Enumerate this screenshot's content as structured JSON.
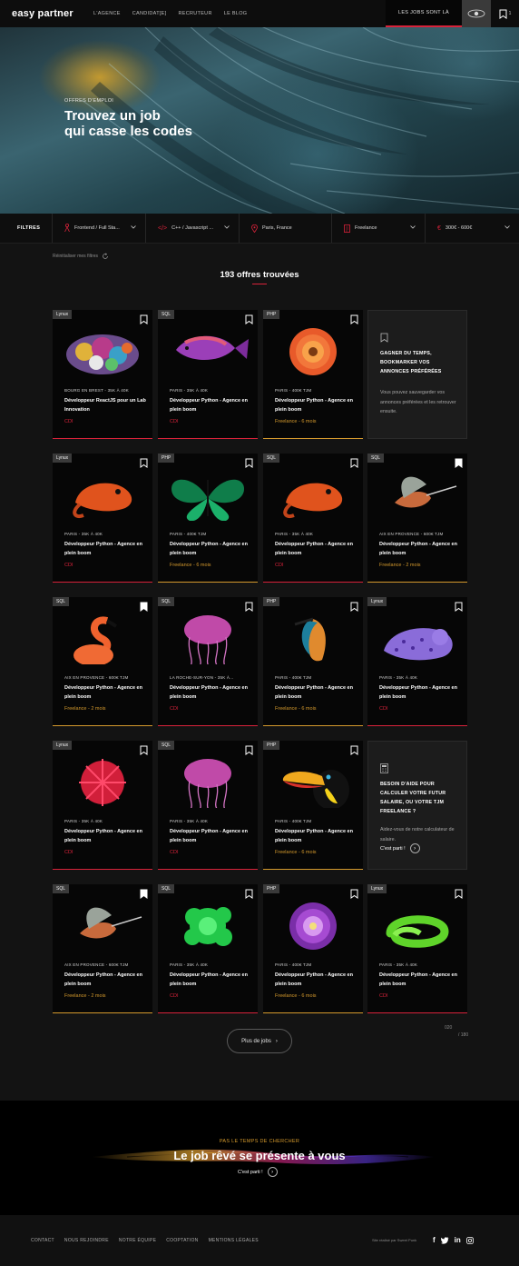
{
  "header": {
    "logo": "easy partner",
    "nav": [
      "L'AGENCE",
      "CANDIDAT[E]",
      "RECRUTEUR",
      "LE BLOG"
    ],
    "jobs_button": "LES JOBS SONT LÀ",
    "bookmark_count": "1"
  },
  "hero": {
    "kicker": "OFFRES D'EMPLOI",
    "title_line1": "Trouvez un job",
    "title_line2": "qui casse les codes"
  },
  "filters": {
    "label": "FILTRES",
    "items": [
      {
        "label": "Frontend / Full Sta...",
        "icon": "person-icon"
      },
      {
        "label": "C++ / Javascript ...",
        "icon": "code-icon"
      },
      {
        "label": "Paris, France",
        "icon": "location-icon"
      },
      {
        "label": "Freelance",
        "icon": "document-icon"
      },
      {
        "label": "300€ - 600€",
        "icon": "euro-icon"
      }
    ],
    "reset": "Réinitialiser mes filtres"
  },
  "results": {
    "title": "193 offres trouvées"
  },
  "colors": {
    "accent_red": "#d8223a",
    "accent_orange": "#d59a2d"
  },
  "cards": [
    {
      "tag": "Lynux",
      "loc": "BOURG EN BREST - 35K À 40K",
      "title": "Développeur ReactJS pour un Lab Innovation",
      "type": "CDI",
      "kind": "cdi",
      "bm": "outline",
      "image": "gemstones"
    },
    {
      "tag": "SQL",
      "loc": "PARIS - 35K À 40K",
      "title": "Développeur Python - Agence en plein boom",
      "type": "CDI",
      "kind": "cdi",
      "bm": "outline",
      "image": "tropical-fish"
    },
    {
      "tag": "PHP",
      "loc": "PARIS - 400€ TJM",
      "title": "Développeur Python - Agence en plein boom",
      "type": "Freelance - 6 mois",
      "kind": "free",
      "bm": "outline",
      "image": "dahlia-flower"
    },
    {
      "promo": true,
      "p_title": "GAGNER DU TEMPS, BOOKMARKER VOS ANNONCES PRÉFÉRÉES",
      "p_text": "Vous pouvez sauvegarder vos annonces préférées et les retrouver ensuite."
    },
    {
      "tag": "Lynux",
      "loc": "PARIS - 35K À 40K",
      "title": "Développeur Python - Agence en plein boom",
      "type": "CDI",
      "kind": "cdi",
      "bm": "outline",
      "image": "chameleon"
    },
    {
      "tag": "PHP",
      "loc": "PARIS - 400€ TJM",
      "title": "Développeur Python - Agence en plein boom",
      "type": "Freelance - 6 mois",
      "kind": "free",
      "bm": "outline",
      "image": "butterfly"
    },
    {
      "tag": "SQL",
      "loc": "PARIS - 35K À 40K",
      "title": "Développeur Python - Agence en plein boom",
      "type": "CDI",
      "kind": "cdi",
      "bm": "outline",
      "image": "chameleon"
    },
    {
      "tag": "SQL",
      "loc": "AIX EN PROVENCE - 600€ TJM",
      "title": "Développeur Python - Agence en plein boom",
      "type": "Freelance - 2 mois",
      "kind": "free",
      "bm": "filled",
      "image": "hummingbird"
    },
    {
      "tag": "SQL",
      "loc": "AIX EN PROVENCE - 600€ TJM",
      "title": "Développeur Python - Agence en plein boom",
      "type": "Freelance - 2 mois",
      "kind": "free",
      "bm": "filled",
      "image": "flamingo"
    },
    {
      "tag": "SQL",
      "loc": "LA ROCHE-SUR-YON - 35K À...",
      "title": "Développeur Python - Agence en plein boom",
      "type": "CDI",
      "kind": "cdi",
      "bm": "outline",
      "image": "jellyfish"
    },
    {
      "tag": "PHP",
      "loc": "PARIS - 400€ TJM",
      "title": "Développeur Python - Agence en plein boom",
      "type": "Freelance - 6 mois",
      "kind": "free",
      "bm": "outline",
      "image": "kingfisher"
    },
    {
      "tag": "Lynux",
      "loc": "PARIS - 35K À 40K",
      "title": "Développeur Python - Agence en plein boom",
      "type": "CDI",
      "kind": "cdi",
      "bm": "outline",
      "image": "snow-leopard"
    },
    {
      "tag": "Lynux",
      "loc": "PARIS - 35K À 40K",
      "title": "Développeur Python - Agence en plein boom",
      "type": "CDI",
      "kind": "cdi",
      "bm": "outline",
      "image": "red-flower"
    },
    {
      "tag": "SQL",
      "loc": "PARIS - 35K À 40K",
      "title": "Développeur Python - Agence en plein boom",
      "type": "CDI",
      "kind": "cdi",
      "bm": "outline",
      "image": "jellyfish"
    },
    {
      "tag": "PHP",
      "loc": "PARIS - 400€ TJM",
      "title": "Développeur Python - Agence en plein boom",
      "type": "Freelance - 6 mois",
      "kind": "free",
      "bm": "outline",
      "image": "toucan"
    },
    {
      "promo": true,
      "p_title": "BESOIN D'AIDE POUR CALCULER VOTRE FUTUR SALAIRE, OU VOTRE TJM FREELANCE ?",
      "p_text": "Aidez-vous de notre calculateur de salaire.",
      "p_cta": "C'est parti !"
    },
    {
      "tag": "SQL",
      "loc": "AIX EN PROVENCE - 600€ TJM",
      "title": "Développeur Python - Agence en plein boom",
      "type": "Freelance - 2 mois",
      "kind": "free",
      "bm": "filled",
      "image": "hummingbird"
    },
    {
      "tag": "SQL",
      "loc": "PARIS - 35K À 40K",
      "title": "Développeur Python - Agence en plein boom",
      "type": "CDI",
      "kind": "cdi",
      "bm": "outline",
      "image": "color-powder"
    },
    {
      "tag": "PHP",
      "loc": "PARIS - 400€ TJM",
      "title": "Développeur Python - Agence en plein boom",
      "type": "Freelance - 6 mois",
      "kind": "free",
      "bm": "outline",
      "image": "purple-dahlia"
    },
    {
      "tag": "Lynux",
      "loc": "PARIS - 35K À 40K",
      "title": "Développeur Python - Agence en plein boom",
      "type": "CDI",
      "kind": "cdi",
      "bm": "outline",
      "image": "green-snake"
    }
  ],
  "pagination": {
    "more": "Plus de jobs",
    "current": "020",
    "total": "180"
  },
  "band": {
    "kicker": "PAS LE TEMPS DE CHERCHER",
    "title": "Le job rêvé se présente à vous",
    "cta": "C'est parti !"
  },
  "footer": {
    "links": [
      "CONTACT",
      "NOUS REJOINDRE",
      "NOTRE ÉQUIPE",
      "COOPTATION",
      "MENTIONS LÉGALES"
    ],
    "credit": "Site réalisé par Sweet Punk",
    "social": [
      "f",
      "t",
      "in",
      "ig"
    ]
  }
}
